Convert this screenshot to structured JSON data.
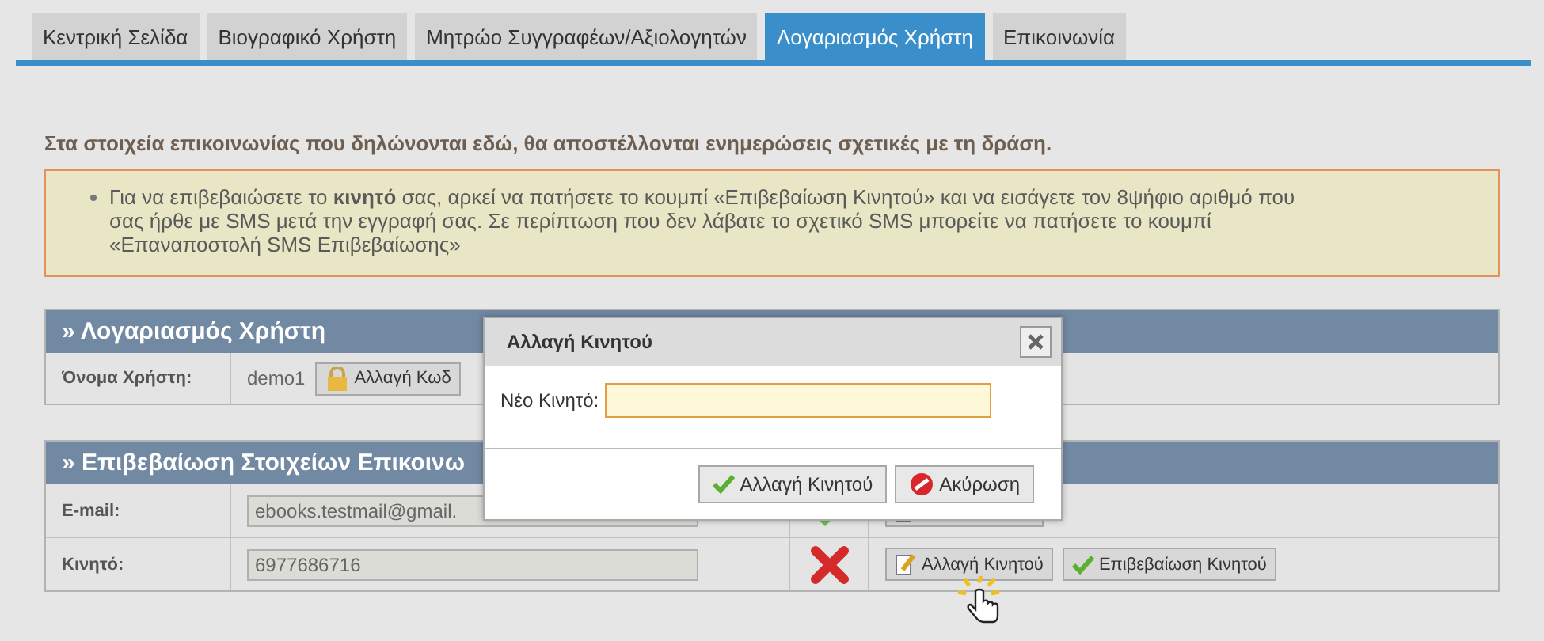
{
  "tabs": [
    {
      "label": "Κεντρική Σελίδα",
      "selected": false
    },
    {
      "label": "Βιογραφικό Χρήστη",
      "selected": false
    },
    {
      "label": "Μητρώο Συγγραφέων/Αξιολογητών",
      "selected": false
    },
    {
      "label": "Λογαριασμός Χρήστη",
      "selected": true
    },
    {
      "label": "Επικοινωνία",
      "selected": false
    }
  ],
  "intro": "Στα στοιχεία επικοινωνίας που δηλώνονται εδώ, θα αποστέλλονται ενημερώσεις σχετικές με τη δράση.",
  "notice": [
    "Για να επιβεβαιώσετε το **κινητό** σας, αρκεί να πατήσετε το κουμπί «Επιβεβαίωση Κινητού» και να εισάγετε τον 8ψήφιο αριθμό που σας ήρθε με SMS μετά την εγγραφή σας. Σε περίπτωση που δεν λάβατε το σχετικό SMS μπορείτε να πατήσετε το κουμπί «Επαναποστολή SMS Επιβεβαίωσης»"
  ],
  "account": {
    "title": "» Λογαριασμός Χρήστη",
    "label": "Όνομα Χρήστη:",
    "value": "demo1",
    "button": "Αλλαγή Κωδ"
  },
  "contact": {
    "title": "» Επιβεβαίωση Στοιχείων Επικοινω",
    "rows": [
      {
        "label": "E-mail:",
        "value": "ebooks.testmail@gmail.",
        "verified": true,
        "buttons": []
      },
      {
        "label": "Κινητό:",
        "value": "6977686716",
        "verified": false,
        "buttons": [
          {
            "label": "Αλλαγή Κινητού",
            "kind": "edit"
          },
          {
            "label": "Επιβεβαίωση Κινητού",
            "kind": "confirm"
          }
        ]
      }
    ]
  },
  "dialog": {
    "title": "Αλλαγή Κινητού",
    "field_label": "Νέο Κινητό:",
    "buttons": [
      {
        "label": "Αλλαγή Κινητού",
        "kind": "confirm"
      },
      {
        "label": "Ακύρωση",
        "kind": "cancel"
      }
    ]
  }
}
